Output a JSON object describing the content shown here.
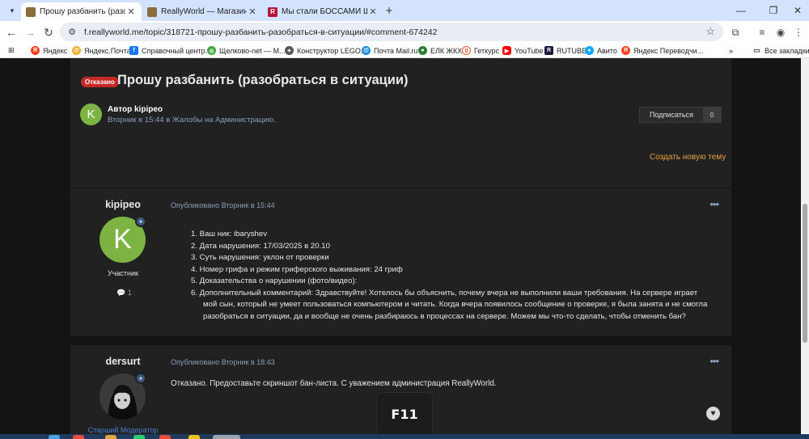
{
  "browser": {
    "tabs": [
      {
        "title": "Прошу разбанить (разобрать",
        "active": true
      },
      {
        "title": "ReallyWorld — Магазин приве",
        "active": false
      },
      {
        "title": "Мы стали БОССАМИ Школ",
        "active": false
      }
    ],
    "url": "f.reallyworld.me/topic/318721-прошу-разбанить-разобраться-в-ситуации/#comment-674242",
    "bookmarks": [
      "Яндекс",
      "Яндекс.Почта",
      "Справочный центр...",
      "Щелково-net — М...",
      "Конструктор LEGO...",
      "Почта Mail.ru",
      "ЕЛК ЖКХ",
      "Геткурс",
      "YouTube",
      "RUTUBE",
      "Авито",
      "Яндекс Переводчи..."
    ],
    "all_bookmarks": "Все закладки"
  },
  "topic": {
    "badge": "Отказано",
    "title": "Прошу разбанить (разобраться в ситуации)",
    "author_initial": "K",
    "author_line": "Автор kipipeo",
    "meta_line": "Вторник в 15:44 в Жалобы на Администрацию.",
    "follow_label": "Подписаться",
    "follow_count": "0",
    "create_topic": "Создать новую тему"
  },
  "posts": [
    {
      "username": "kipipeo",
      "avatar_initial": "K",
      "role": "Участник",
      "count": "1",
      "date": "Опубликовано Вторник в 15:44",
      "items": [
        "1.  Ваш ник: ibaryshev",
        "2.  Дата нарушения: 17/03/2025 в 20.10",
        "3.  Суть нарушения: уклон от проверки",
        "4.  Номер грифа и режим гриферского выживания: 24 гриф",
        "5.  Доказательства о нарушении (фото/видео):",
        "6.  Дополнительный комментарий: Здравствуйте! Хотелось бы объяснить, почему вчера не выполнили ваши требования. На сервере играет мой сын, который не умеет пользоваться компьютером и читать. Когда вчера появилось сообщение о проверке, я была занята и не смогла разобраться в ситуации, да и вообще не очень разбираюсь в процессах на сервере. Можем мы что-то сделать, чтобы отменить бан?"
      ]
    },
    {
      "username": "dersurt",
      "role": "Старший Модератор",
      "date": "Опубликовано Вторник в 18:43",
      "body": "Отказано. Предоставьте скриншот бан-листа. С уважением администрация ReallyWorld."
    }
  ],
  "overlay_key": "F11"
}
